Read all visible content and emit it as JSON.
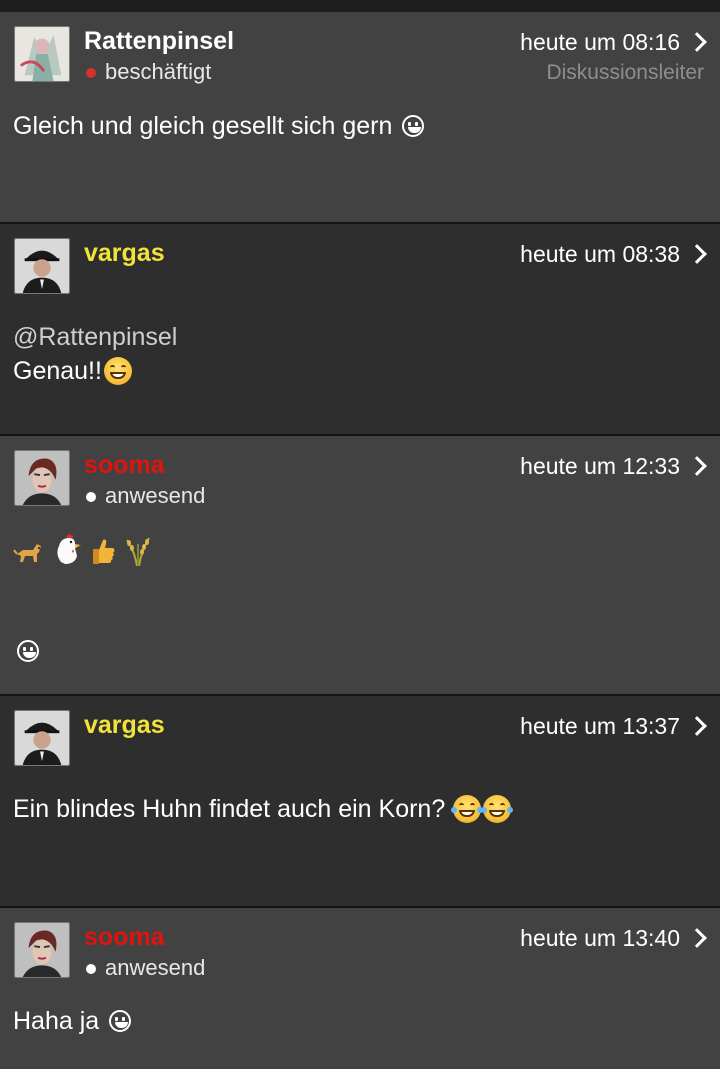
{
  "posts": [
    {
      "username": "Rattenpinsel",
      "username_color": "#ffffff",
      "status": "beschäftigt",
      "status_color": "#d9312b",
      "time": "heute um 08:16",
      "role": "Diskussionsleiter",
      "text": "Gleich und gleich gesellt sich gern",
      "emoji": "smile-outline-icon"
    },
    {
      "username": "vargas",
      "username_color": "#f2e33b",
      "time": "heute um 08:38",
      "mention": "@Rattenpinsel",
      "text": "Genau!!",
      "emoji": "grinning-face-icon"
    },
    {
      "username": "sooma",
      "username_color": "#e0140f",
      "status": "anwesend",
      "status_color": "#ffffff",
      "time": "heute um 12:33",
      "emojis": [
        "dog-icon",
        "chicken-icon",
        "thumbs-up-icon",
        "rice-sheaf-icon"
      ],
      "trailing_emoji": "smile-outline-icon"
    },
    {
      "username": "vargas",
      "username_color": "#f2e33b",
      "time": "heute um 13:37",
      "text": "Ein blindes Huhn findet auch ein Korn?",
      "emojis": [
        "tears-of-joy-icon",
        "tears-of-joy-icon"
      ]
    },
    {
      "username": "sooma",
      "username_color": "#e0140f",
      "status": "anwesend",
      "status_color": "#ffffff",
      "time": "heute um 13:40",
      "text": "Haha ja",
      "emoji": "smile-outline-icon"
    }
  ]
}
